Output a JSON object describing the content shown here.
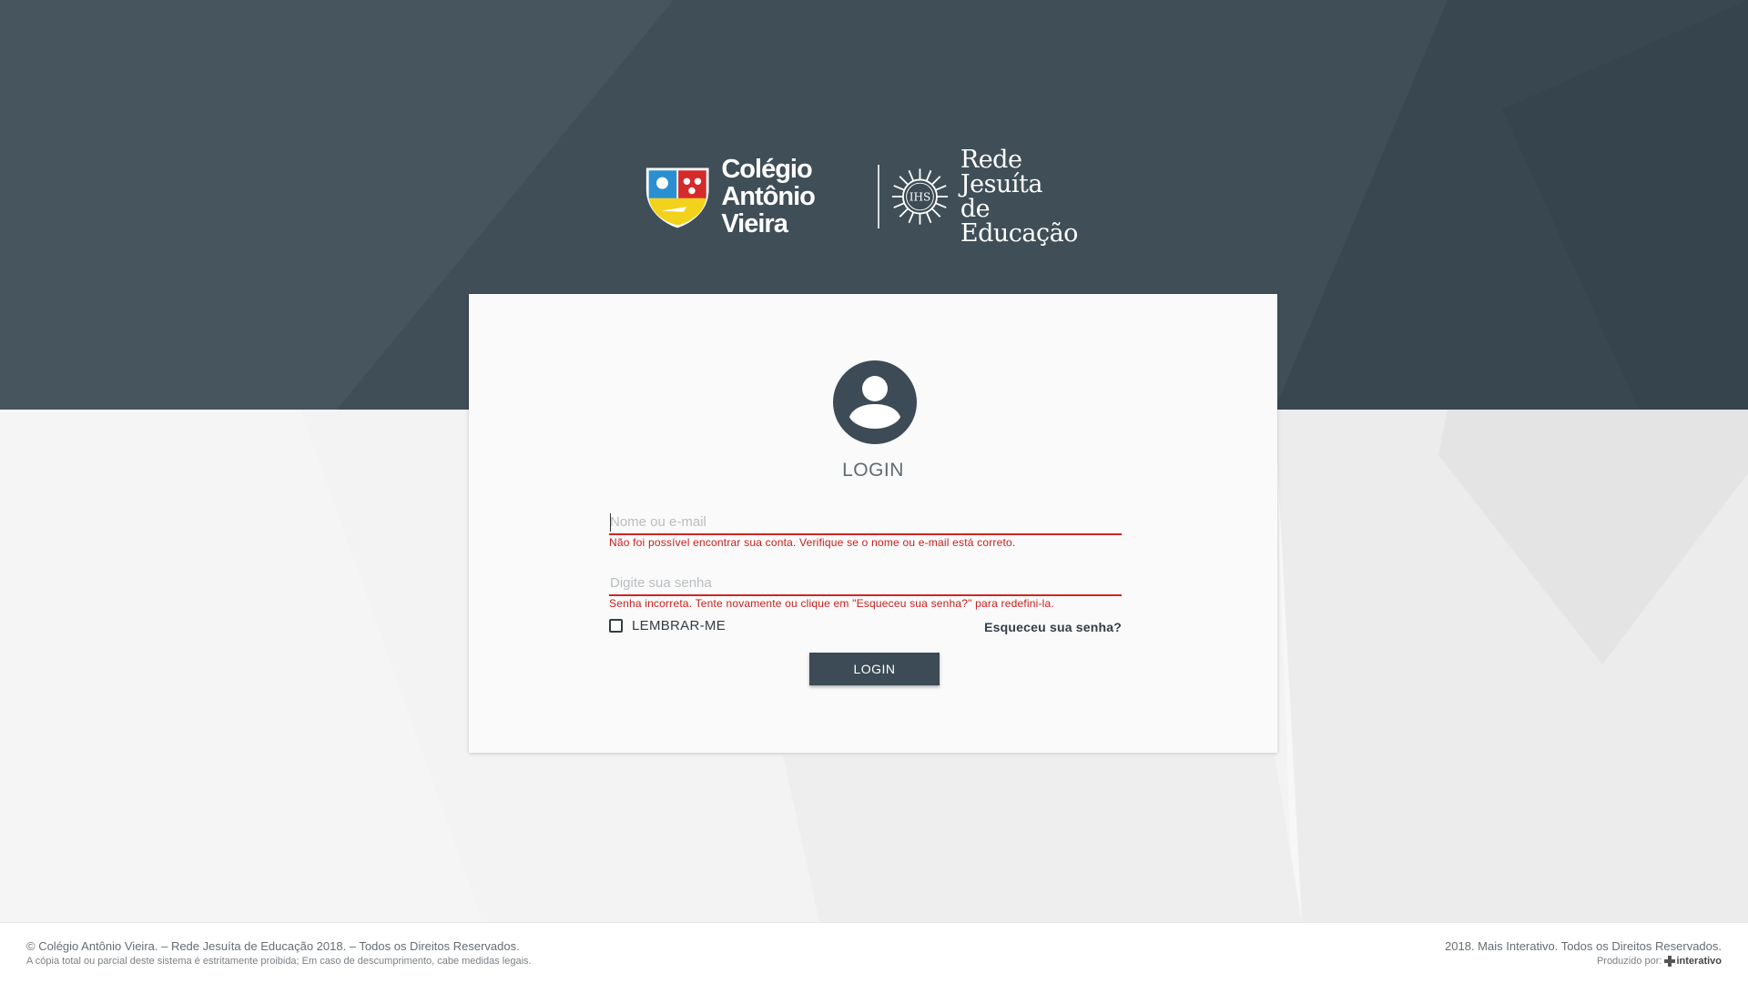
{
  "brand": {
    "college_line1": "Colégio",
    "college_line2": "Antônio Vieira",
    "network_line1": "Rede Jesuíta",
    "network_line2": "de Educação"
  },
  "login": {
    "title": "LOGIN",
    "username_placeholder": "Nome ou e-mail",
    "username_error": "Não foi possível encontrar sua conta. Verifique se o nome ou e-mail está correto.",
    "password_placeholder": "Digite sua senha",
    "password_error": "Senha incorreta. Tente novamente ou clique em \"Esqueceu sua senha?\" para redefini-la.",
    "remember_label": "LEMBRAR-ME",
    "remember_checked": false,
    "forgot_label": "Esqueceu sua senha?",
    "submit_label": "LOGIN"
  },
  "footer": {
    "left_main": "© Colégio Antônio Vieira. – Rede Jesuíta de Educação 2018. – Todos os Direitos Reservados.",
    "left_sub": "A cópia total ou parcial deste sistema é estritamente proibida; Em caso de descumprimento, cabe medidas legais.",
    "right_main": "2018. Mais Interativo. Todos os Direitos Reservados.",
    "right_sub": "Produzido por:",
    "producer_logo": "interativo"
  },
  "colors": {
    "header_bg": "#3c4b55",
    "error": "#c81e1e",
    "button_bg": "#3c4b55"
  },
  "icons": {
    "avatar": "account-circle-icon",
    "crest": "college-crest-icon",
    "network": "jesuit-sun-ihs-icon"
  }
}
